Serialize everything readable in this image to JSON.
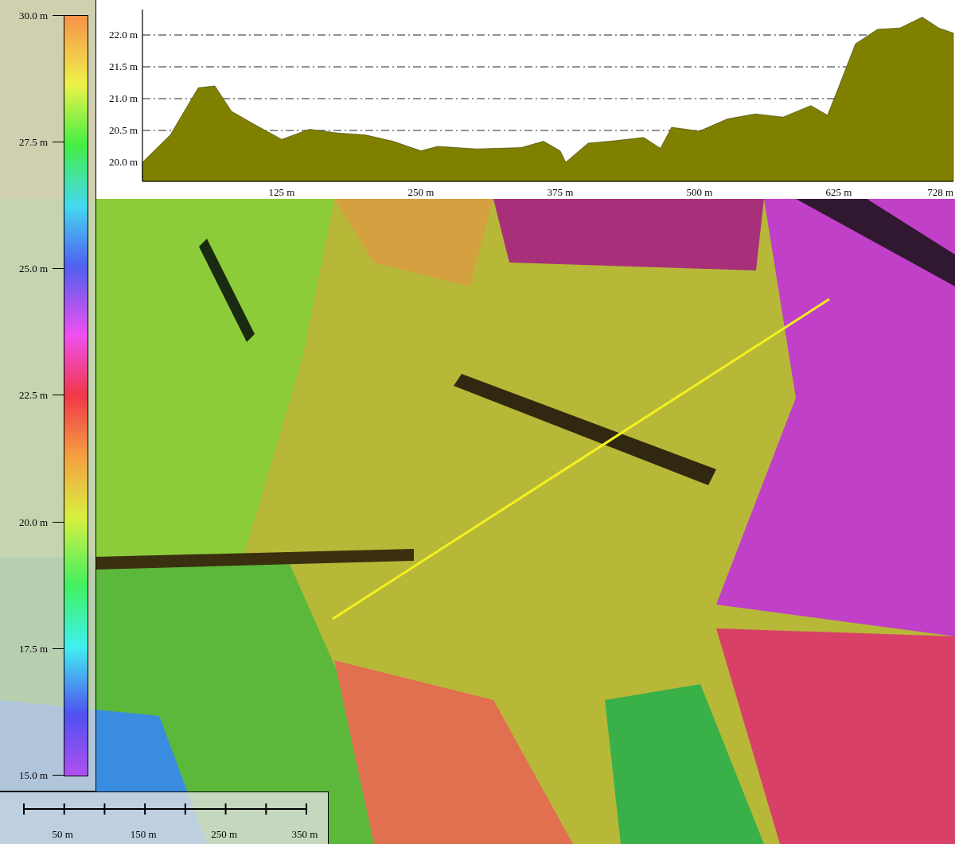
{
  "legend": {
    "labels": [
      "30.0 m",
      "27.5 m",
      "25.0 m",
      "22.5 m",
      "20.0 m",
      "17.5 m",
      "15.0 m"
    ]
  },
  "profile": {
    "chart_data": {
      "type": "area",
      "x": [
        0,
        25,
        50,
        65,
        80,
        100,
        125,
        150,
        175,
        200,
        225,
        250,
        265,
        300,
        340,
        360,
        375,
        380,
        400,
        425,
        450,
        465,
        475,
        500,
        525,
        550,
        575,
        600,
        615,
        625,
        640,
        660,
        680,
        700,
        715,
        728
      ],
      "series": [
        {
          "color": "#808000",
          "values": [
            20.0,
            20.43,
            21.17,
            21.2,
            20.8,
            20.6,
            20.36,
            20.52,
            20.46,
            20.43,
            20.33,
            20.18,
            20.25,
            20.21,
            20.23,
            20.33,
            20.18,
            20.0,
            20.3,
            20.34,
            20.39,
            20.22,
            20.55,
            20.49,
            20.68,
            20.76,
            20.71,
            20.89,
            20.74,
            21.18,
            21.86,
            22.09,
            22.11,
            22.28,
            22.11,
            22.03
          ]
        }
      ],
      "xlim": [
        0,
        728
      ],
      "ylim": [
        19.7,
        22.4
      ],
      "grid": true,
      "xticks": [
        {
          "value": 125,
          "label": "125 m"
        },
        {
          "value": 250,
          "label": "250 m"
        },
        {
          "value": 375,
          "label": "375 m"
        },
        {
          "value": 500,
          "label": "500 m"
        },
        {
          "value": 625,
          "label": "625 m"
        },
        {
          "value": 728,
          "label": "728 m"
        }
      ],
      "yticks": [
        {
          "value": 20.0,
          "label": "20.0 m"
        },
        {
          "value": 20.5,
          "label": "20.5 m"
        },
        {
          "value": 21.0,
          "label": "21.0 m"
        },
        {
          "value": 21.5,
          "label": "21.5 m"
        },
        {
          "value": 22.0,
          "label": "22.0 m"
        }
      ]
    }
  },
  "scale_bar": {
    "labels": [
      "50 m",
      "150 m",
      "250 m",
      "350 m"
    ]
  }
}
